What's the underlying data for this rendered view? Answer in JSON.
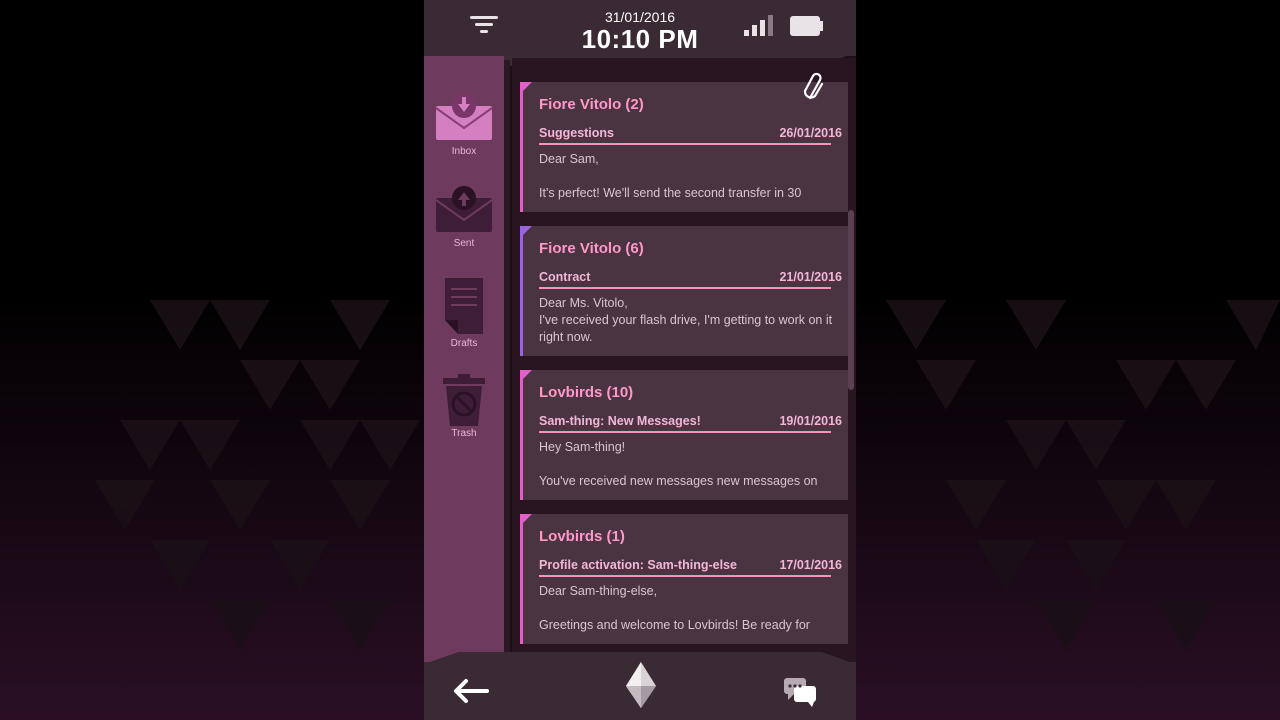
{
  "status": {
    "date": "31/01/2016",
    "time": "10:10 PM"
  },
  "sidebar": {
    "items": [
      {
        "label": "Inbox",
        "icon": "inbox-icon"
      },
      {
        "label": "Sent",
        "icon": "sent-icon"
      },
      {
        "label": "Drafts",
        "icon": "drafts-icon"
      },
      {
        "label": "Trash",
        "icon": "trash-icon"
      }
    ]
  },
  "mails": [
    {
      "sender": "Fiore Vitolo (2)",
      "subject": "Suggestions",
      "date": "26/01/2016",
      "body": "Dear Sam,\n\nIt's perfect! We'll send the second transfer in 30"
    },
    {
      "sender": "Fiore Vitolo (6)",
      "subject": "Contract",
      "date": "21/01/2016",
      "body": "Dear Ms. Vitolo,\nI've received your flash drive, I'm getting to work on it right now."
    },
    {
      "sender": "Lovbirds (10)",
      "subject": "Sam-thing: New Messages!",
      "date": "19/01/2016",
      "body": "Hey Sam-thing!\n\nYou've received new messages new messages on"
    },
    {
      "sender": "Lovbirds (1)",
      "subject": "Profile activation: Sam-thing-else",
      "date": "17/01/2016",
      "body": "Dear Sam-thing-else,\n\nGreetings and welcome to Lovbirds! Be ready for"
    }
  ],
  "colors": {
    "accent_pink": "#e25ec8",
    "accent_purple": "#9a64e0",
    "sidebar": "#6e3a5e",
    "card": "#4b3441"
  },
  "icons": {
    "filter": "filter-icon",
    "signal": "signal-icon",
    "battery": "battery-icon",
    "attachment": "paperclip-icon",
    "back": "back-arrow-icon",
    "home": "crystal-home-icon",
    "chat": "chat-bubbles-icon"
  }
}
